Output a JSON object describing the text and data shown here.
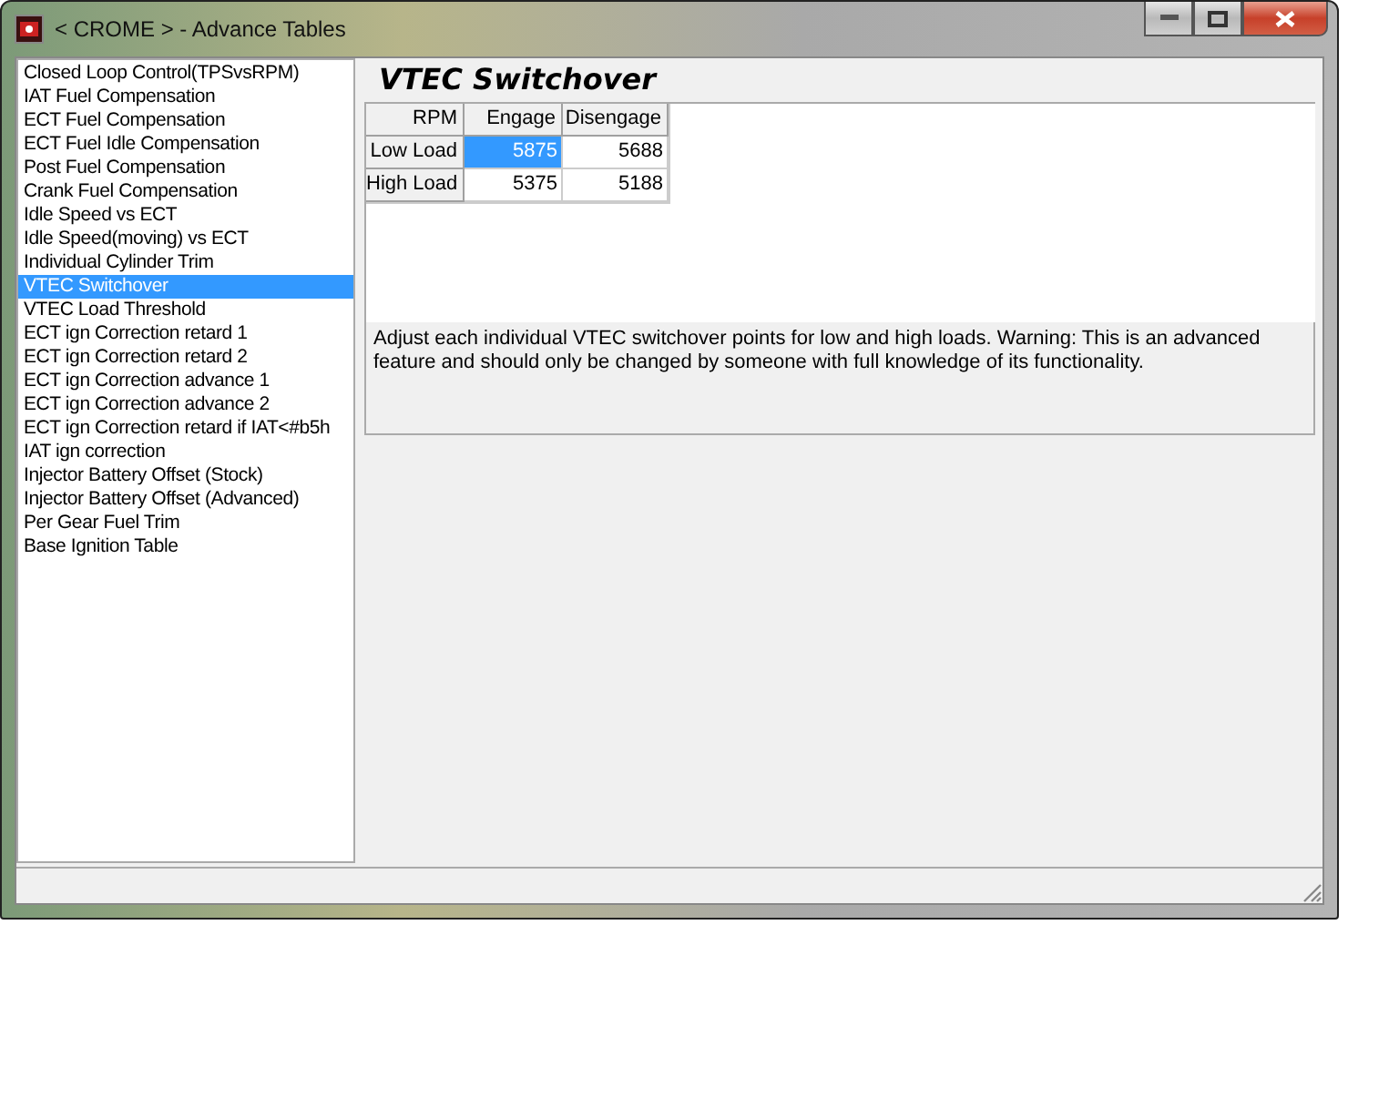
{
  "window": {
    "title": "< CROME > - Advance Tables"
  },
  "sidebar": {
    "items": [
      {
        "label": "Closed Loop Control(TPSvsRPM)",
        "selected": false
      },
      {
        "label": "IAT Fuel Compensation",
        "selected": false
      },
      {
        "label": "ECT Fuel Compensation",
        "selected": false
      },
      {
        "label": "ECT Fuel Idle Compensation",
        "selected": false
      },
      {
        "label": "Post Fuel Compensation",
        "selected": false
      },
      {
        "label": "Crank Fuel Compensation",
        "selected": false
      },
      {
        "label": "Idle Speed vs ECT",
        "selected": false
      },
      {
        "label": "Idle Speed(moving) vs ECT",
        "selected": false
      },
      {
        "label": "Individual Cylinder Trim",
        "selected": false
      },
      {
        "label": "VTEC Switchover",
        "selected": true
      },
      {
        "label": "VTEC Load Threshold",
        "selected": false
      },
      {
        "label": "ECT ign Correction retard 1",
        "selected": false
      },
      {
        "label": "ECT ign Correction retard 2",
        "selected": false
      },
      {
        "label": "ECT ign Correction advance 1",
        "selected": false
      },
      {
        "label": "ECT ign Correction advance 2",
        "selected": false
      },
      {
        "label": "ECT ign Correction retard if IAT<#b5h",
        "selected": false
      },
      {
        "label": "IAT ign correction",
        "selected": false
      },
      {
        "label": "Injector Battery Offset (Stock)",
        "selected": false
      },
      {
        "label": "Injector Battery Offset (Advanced)",
        "selected": false
      },
      {
        "label": "Per Gear Fuel Trim",
        "selected": false
      },
      {
        "label": "Base Ignition Table",
        "selected": false
      }
    ]
  },
  "panel": {
    "title": "VTEC Switchover",
    "table": {
      "corner": "RPM",
      "columns": [
        "Engage",
        "Disengage"
      ],
      "rows": [
        {
          "label": "Low Load",
          "cells": [
            {
              "value": "5875",
              "selected": true
            },
            {
              "value": "5688",
              "selected": false
            }
          ]
        },
        {
          "label": "High Load",
          "cells": [
            {
              "value": "5375",
              "selected": false
            },
            {
              "value": "5188",
              "selected": false
            }
          ]
        }
      ]
    },
    "description": "Adjust each individual VTEC switchover points for low and high loads. Warning: This is an advanced feature and should only be changed by someone with full knowledge of its functionality."
  }
}
